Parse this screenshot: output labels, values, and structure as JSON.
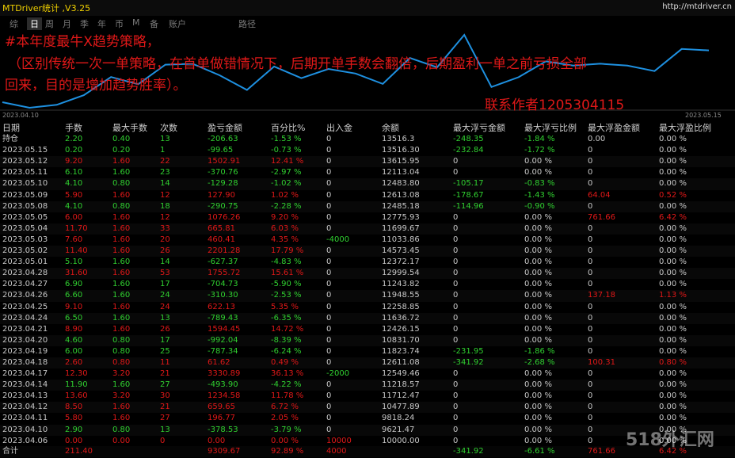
{
  "titlebar": {
    "app_title": "MTDriver统计 ,V3.25",
    "site": "http://mtdriver.cn"
  },
  "tabs": [
    "综",
    "日",
    "周",
    "月",
    "季",
    "年",
    "币",
    "M",
    "备",
    "账户",
    "路径"
  ],
  "active_tab": 1,
  "chart": {
    "start_label": "2023.04.10",
    "end_label": "2023.05.15",
    "line_color": "#1e90e0"
  },
  "annotations": {
    "line1": "#本年度最牛X趋势策略，",
    "line2": "（区别传统一次一单策略，在首单做错情况下，后期开单手数会翻倍，后期盈利一单之前亏损全部",
    "line3": "回来，目的是增加趋势胜率）。",
    "contact": "联系作者1205304115"
  },
  "columns": [
    "日期",
    "手数",
    "最大手数",
    "次数",
    "盈亏金额",
    "百分比%",
    "出入金",
    "余额",
    "最大浮亏金额",
    "最大浮亏比例",
    "最大浮盈金额",
    "最大浮盈比例"
  ],
  "holding": {
    "label": "持仓",
    "cells": [
      "2.20",
      "0.40",
      "13",
      "-206.63",
      "-1.53 %",
      "0",
      "13516.3",
      "-248.35",
      "-1.84 %",
      "0.00",
      "0.00 %"
    ]
  },
  "rows": [
    [
      "2023.05.15",
      "0.20",
      "0.20",
      "1",
      "-99.65",
      "-0.73 %",
      "0",
      "13516.30",
      "-232.84",
      "-1.72 %",
      "0",
      "0.00 %"
    ],
    [
      "2023.05.12",
      "9.20",
      "1.60",
      "22",
      "1502.91",
      "12.41 %",
      "0",
      "13615.95",
      "0",
      "0.00 %",
      "0",
      "0.00 %"
    ],
    [
      "2023.05.11",
      "6.10",
      "1.60",
      "23",
      "-370.76",
      "-2.97 %",
      "0",
      "12113.04",
      "0",
      "0.00 %",
      "0",
      "0.00 %"
    ],
    [
      "2023.05.10",
      "4.10",
      "0.80",
      "14",
      "-129.28",
      "-1.02 %",
      "0",
      "12483.80",
      "-105.17",
      "-0.83 %",
      "0",
      "0.00 %"
    ],
    [
      "2023.05.09",
      "5.90",
      "1.60",
      "12",
      "127.90",
      "1.02 %",
      "0",
      "12613.08",
      "-178.67",
      "-1.43 %",
      "64.04",
      "0.52 %"
    ],
    [
      "2023.05.08",
      "4.10",
      "0.80",
      "18",
      "-290.75",
      "-2.28 %",
      "0",
      "12485.18",
      "-114.96",
      "-0.90 %",
      "0",
      "0.00 %"
    ],
    [
      "2023.05.05",
      "6.00",
      "1.60",
      "12",
      "1076.26",
      "9.20 %",
      "0",
      "12775.93",
      "0",
      "0.00 %",
      "761.66",
      "6.42 %"
    ],
    [
      "2023.05.04",
      "11.70",
      "1.60",
      "33",
      "665.81",
      "6.03 %",
      "0",
      "11699.67",
      "0",
      "0.00 %",
      "0",
      "0.00 %"
    ],
    [
      "2023.05.03",
      "7.60",
      "1.60",
      "20",
      "460.41",
      "4.35 %",
      "-4000",
      "11033.86",
      "0",
      "0.00 %",
      "0",
      "0.00 %"
    ],
    [
      "2023.05.02",
      "11.40",
      "1.60",
      "26",
      "2201.28",
      "17.79 %",
      "0",
      "14573.45",
      "0",
      "0.00 %",
      "0",
      "0.00 %"
    ],
    [
      "2023.05.01",
      "5.10",
      "1.60",
      "14",
      "-627.37",
      "-4.83 %",
      "0",
      "12372.17",
      "0",
      "0.00 %",
      "0",
      "0.00 %"
    ],
    [
      "2023.04.28",
      "31.60",
      "1.60",
      "53",
      "1755.72",
      "15.61 %",
      "0",
      "12999.54",
      "0",
      "0.00 %",
      "0",
      "0.00 %"
    ],
    [
      "2023.04.27",
      "6.90",
      "1.60",
      "17",
      "-704.73",
      "-5.90 %",
      "0",
      "11243.82",
      "0",
      "0.00 %",
      "0",
      "0.00 %"
    ],
    [
      "2023.04.26",
      "6.60",
      "1.60",
      "24",
      "-310.30",
      "-2.53 %",
      "0",
      "11948.55",
      "0",
      "0.00 %",
      "137.18",
      "1.13 %"
    ],
    [
      "2023.04.25",
      "9.10",
      "1.60",
      "24",
      "622.13",
      "5.35 %",
      "0",
      "12258.85",
      "0",
      "0.00 %",
      "0",
      "0.00 %"
    ],
    [
      "2023.04.24",
      "6.50",
      "1.60",
      "13",
      "-789.43",
      "-6.35 %",
      "0",
      "11636.72",
      "0",
      "0.00 %",
      "0",
      "0.00 %"
    ],
    [
      "2023.04.21",
      "8.90",
      "1.60",
      "26",
      "1594.45",
      "14.72 %",
      "0",
      "12426.15",
      "0",
      "0.00 %",
      "0",
      "0.00 %"
    ],
    [
      "2023.04.20",
      "4.60",
      "0.80",
      "17",
      "-992.04",
      "-8.39 %",
      "0",
      "10831.70",
      "0",
      "0.00 %",
      "0",
      "0.00 %"
    ],
    [
      "2023.04.19",
      "6.00",
      "0.80",
      "25",
      "-787.34",
      "-6.24 %",
      "0",
      "11823.74",
      "-231.95",
      "-1.86 %",
      "0",
      "0.00 %"
    ],
    [
      "2023.04.18",
      "2.60",
      "0.80",
      "11",
      "61.62",
      "0.49 %",
      "0",
      "12611.08",
      "-341.92",
      "-2.68 %",
      "100.31",
      "0.80 %"
    ],
    [
      "2023.04.17",
      "12.30",
      "3.20",
      "21",
      "3330.89",
      "36.13 %",
      "-2000",
      "12549.46",
      "0",
      "0.00 %",
      "0",
      "0.00 %"
    ],
    [
      "2023.04.14",
      "11.90",
      "1.60",
      "27",
      "-493.90",
      "-4.22 %",
      "0",
      "11218.57",
      "0",
      "0.00 %",
      "0",
      "0.00 %"
    ],
    [
      "2023.04.13",
      "13.60",
      "3.20",
      "30",
      "1234.58",
      "11.78 %",
      "0",
      "11712.47",
      "0",
      "0.00 %",
      "0",
      "0.00 %"
    ],
    [
      "2023.04.12",
      "8.50",
      "1.60",
      "21",
      "659.65",
      "6.72 %",
      "0",
      "10477.89",
      "0",
      "0.00 %",
      "0",
      "0.00 %"
    ],
    [
      "2023.04.11",
      "5.80",
      "1.60",
      "27",
      "196.77",
      "2.05 %",
      "0",
      "9818.24",
      "0",
      "0.00 %",
      "0",
      "0.00 %"
    ],
    [
      "2023.04.10",
      "2.90",
      "0.80",
      "13",
      "-378.53",
      "-3.79 %",
      "0",
      "9621.47",
      "0",
      "0.00 %",
      "0",
      "0.00 %"
    ],
    [
      "2023.04.06",
      "0.00",
      "0.00",
      "0",
      "0.00",
      "0.00 %",
      "10000",
      "10000.00",
      "0",
      "0.00 %",
      "0",
      "0.00 %"
    ]
  ],
  "total": {
    "label": "合计",
    "lots": "211.40",
    "pnl": "9309.67",
    "pct": "92.89 %",
    "flow": "4000",
    "max_loss": "-341.92",
    "max_loss_pct": "-6.61 %",
    "max_gain": "761.66",
    "max_gain_pct": "6.42 %"
  },
  "watermark": "518外汇网"
}
